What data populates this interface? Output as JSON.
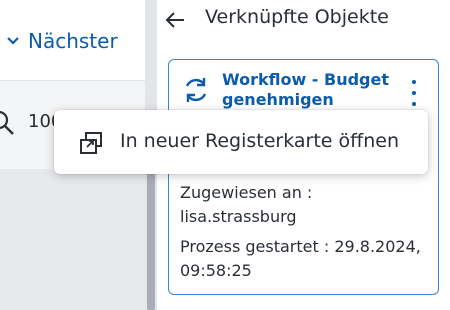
{
  "left": {
    "next_label": "Nächster",
    "zoom_value": "100"
  },
  "panel": {
    "title": "Verknüpfte Objekte"
  },
  "card": {
    "title": "Workflow - Budget genehmigen",
    "assigned_label": "Zugewiesen an :",
    "assigned_user": "lisa.strassburg",
    "started_label": "Prozess gestartet : 29.8.2024,",
    "started_time": "09:58:25"
  },
  "context_menu": {
    "items": [
      {
        "label": "In neuer Registerkarte öffnen",
        "icon": "open-in-new-tab-icon"
      }
    ]
  },
  "colors": {
    "accent": "#0b5cad",
    "card_border": "#3a86d6",
    "text": "#2a2f36"
  }
}
